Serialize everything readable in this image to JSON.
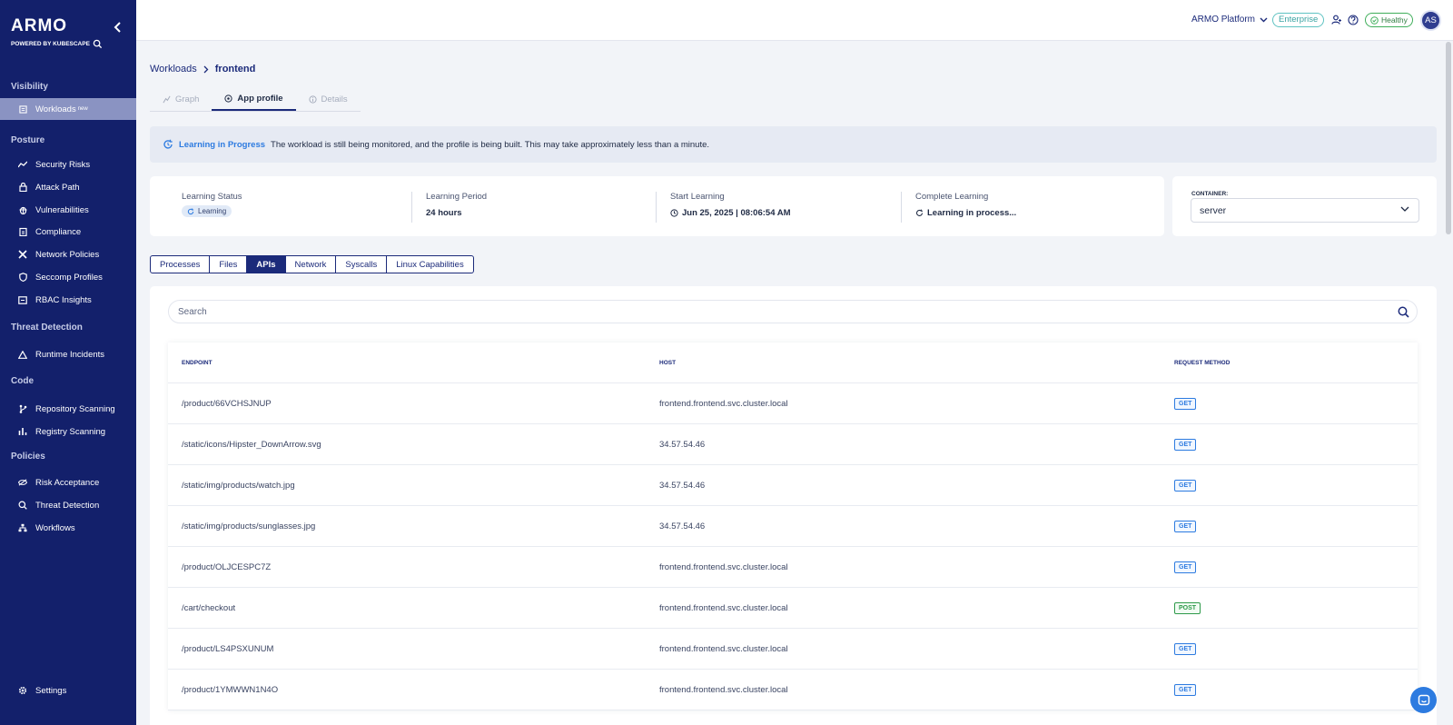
{
  "brand": {
    "logo": "ARMO",
    "powered_by": "POWERED BY KUBESCAPE"
  },
  "sidebar": {
    "sections": {
      "visibility": "Visibility",
      "posture": "Posture",
      "threat_detection": "Threat Detection",
      "code": "Code",
      "policies": "Policies"
    },
    "items": {
      "workloads": {
        "label": "Workloads",
        "badge": "new"
      },
      "security_risks": "Security Risks",
      "attack_path": "Attack Path",
      "vulnerabilities": "Vulnerabilities",
      "compliance": "Compliance",
      "network_policies": "Network Policies",
      "seccomp_profiles": "Seccomp Profiles",
      "rbac_insights": "RBAC Insights",
      "runtime_incidents": "Runtime Incidents",
      "repository_scanning": "Repository Scanning",
      "registry_scanning": "Registry Scanning",
      "risk_acceptance": "Risk Acceptance",
      "threat_detection": "Threat Detection",
      "workflows": "Workflows",
      "settings": "Settings"
    }
  },
  "topbar": {
    "platform": "ARMO Platform",
    "plan": "Enterprise",
    "health": "Healthy",
    "avatar_initials": "AS"
  },
  "breadcrumb": {
    "parent": "Workloads",
    "current": "frontend"
  },
  "tabs": {
    "graph": "Graph",
    "app_profile": "App profile",
    "details": "Details"
  },
  "banner": {
    "title": "Learning in Progress",
    "message": "The workload is still being monitored, and the profile is being built. This may take approximately less than a minute."
  },
  "status": {
    "learning_status": {
      "label": "Learning Status",
      "value": "Learning"
    },
    "learning_period": {
      "label": "Learning Period",
      "value": "24 hours"
    },
    "start_learning": {
      "label": "Start Learning",
      "value": "Jun 25, 2025 | 08:06:54 AM"
    },
    "complete_learning": {
      "label": "Complete Learning",
      "value": "Learning in process..."
    }
  },
  "container": {
    "label": "CONTAINER:",
    "value": "server"
  },
  "profile_tabs": [
    "Processes",
    "Files",
    "APIs",
    "Network",
    "Syscalls",
    "Linux Capabilities"
  ],
  "search": {
    "placeholder": "Search"
  },
  "table": {
    "headers": {
      "endpoint": "ENDPOINT",
      "host": "HOST",
      "method": "REQUEST METHOD"
    },
    "rows": [
      {
        "endpoint": "/product/66VCHSJNUP",
        "host": "frontend.frontend.svc.cluster.local",
        "method": "GET"
      },
      {
        "endpoint": "/static/icons/Hipster_DownArrow.svg",
        "host": "34.57.54.46",
        "method": "GET"
      },
      {
        "endpoint": "/static/img/products/watch.jpg",
        "host": "34.57.54.46",
        "method": "GET"
      },
      {
        "endpoint": "/static/img/products/sunglasses.jpg",
        "host": "34.57.54.46",
        "method": "GET"
      },
      {
        "endpoint": "/product/OLJCESPC7Z",
        "host": "frontend.frontend.svc.cluster.local",
        "method": "GET"
      },
      {
        "endpoint": "/cart/checkout",
        "host": "frontend.frontend.svc.cluster.local",
        "method": "POST"
      },
      {
        "endpoint": "/product/LS4PSXUNUM",
        "host": "frontend.frontend.svc.cluster.local",
        "method": "GET"
      },
      {
        "endpoint": "/product/1YMWWN1N4O",
        "host": "frontend.frontend.svc.cluster.local",
        "method": "GET"
      }
    ]
  },
  "colors": {
    "sidebar": "#13206b",
    "accent": "#1b2a7a",
    "link": "#2d7be0",
    "healthy": "#3fae5a",
    "enterprise": "#5fc3c2"
  }
}
